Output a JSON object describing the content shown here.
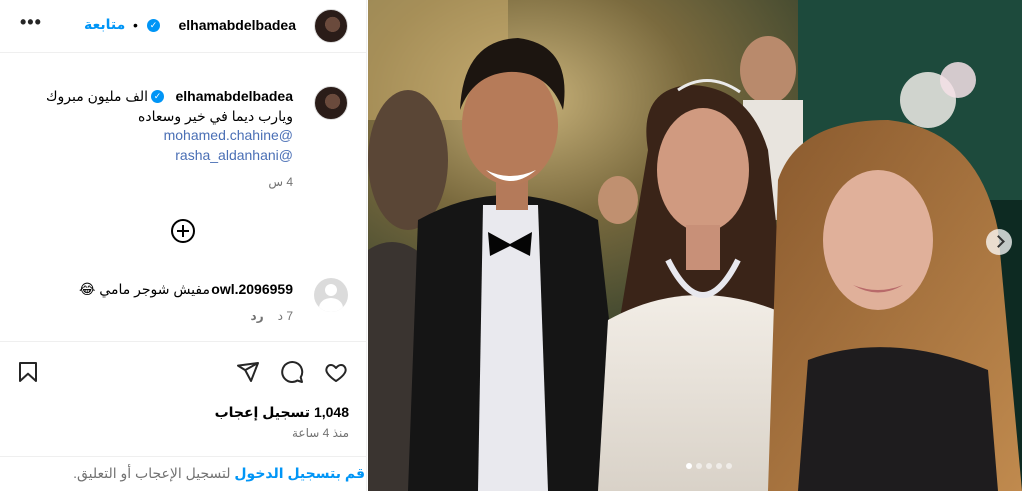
{
  "header": {
    "username": "elhamabdelbadea",
    "dot": "•",
    "follow_label": "متابعة",
    "more_label": "•••"
  },
  "caption": {
    "username": "elhamabdelbadea",
    "line1": "الف مليون مبروك",
    "line2": "ويارب ديما في خير وسعاده",
    "mention1": "@mohamed.chahine",
    "mention2": "@rasha_aldanhani",
    "time": "4 س"
  },
  "comment": {
    "username": "owl.2096959",
    "text": "مفيش شوجر مامي 😂",
    "time": "7 د",
    "reply_label": "رد"
  },
  "actions": {
    "likes": "1,048 تسجيل إعجاب",
    "since": "منذ 4 ساعة",
    "login_link": "قم بتسجيل الدخول",
    "login_rest": " لتسجيل الإعجاب أو التعليق."
  },
  "icons": {
    "verified": "verified-badge-icon",
    "add": "plus-circle-icon",
    "like": "heart-icon",
    "comment": "speech-bubble-icon",
    "share": "paper-plane-icon",
    "save": "bookmark-icon",
    "next": "chevron-right-icon"
  },
  "colors": {
    "accent": "#0095f6",
    "mention": "#4a6fb5",
    "muted": "#737373"
  }
}
